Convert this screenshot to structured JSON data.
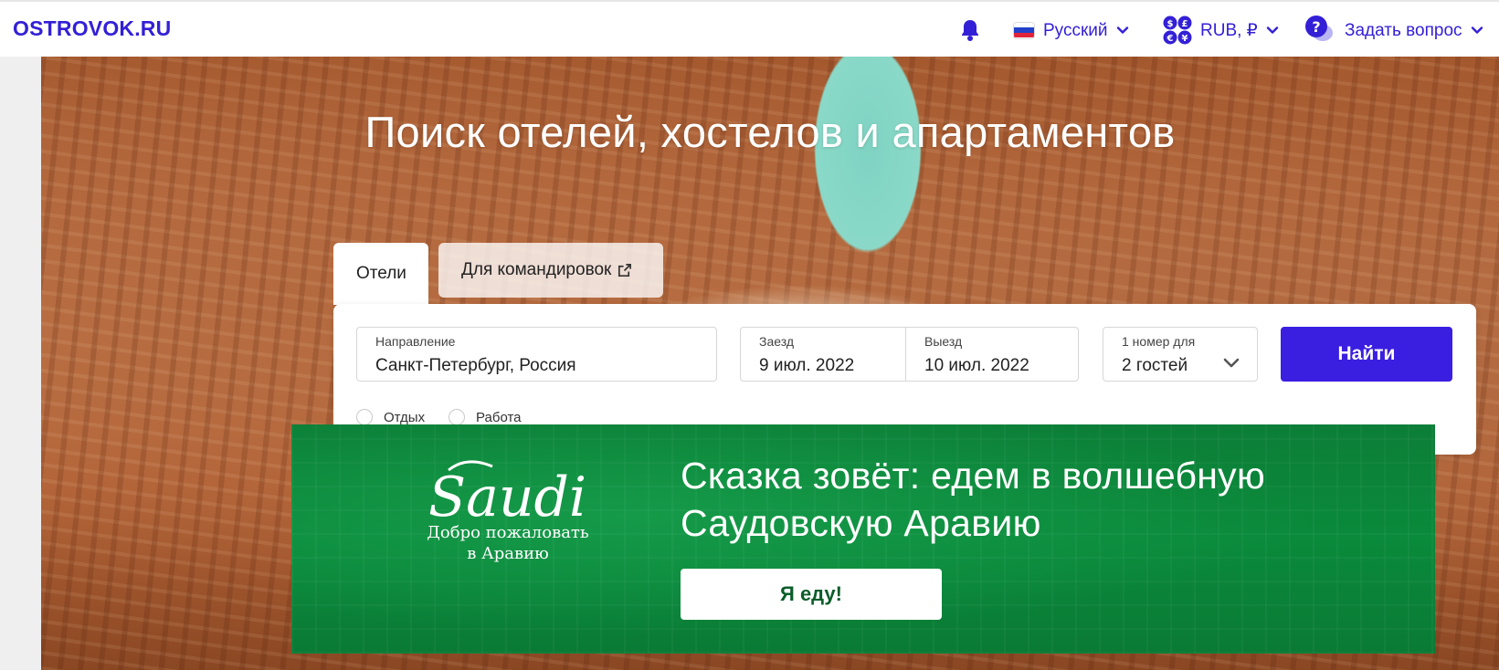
{
  "header": {
    "logo": "OSTROVOK.RU",
    "language": "Русский",
    "currency": "RUB, ₽",
    "help": "Задать вопрос"
  },
  "icons": {
    "bell": "bell-icon",
    "flag": "russia-flag-icon",
    "currency": "currency-exchange-icon",
    "help": "question-bubble-icon",
    "chevron": "chevron-down-icon",
    "external": "external-link-icon"
  },
  "colors": {
    "brand": "#3320d6",
    "search_button": "#3a1fe0",
    "promo_green": "#0a8a3b"
  },
  "hero": {
    "title": "Поиск отелей, хостелов и апартаментов"
  },
  "tabs": [
    {
      "label": "Отели",
      "active": true
    },
    {
      "label": "Для командировок",
      "active": false
    }
  ],
  "search": {
    "destination": {
      "label": "Направление",
      "value": "Санкт-Петербург, Россия"
    },
    "checkin": {
      "label": "Заезд",
      "value": "9 июл. 2022"
    },
    "checkout": {
      "label": "Выезд",
      "value": "10 июл. 2022"
    },
    "guests": {
      "label": "1 номер для",
      "value": "2 гостей"
    },
    "button": "Найти",
    "purpose": [
      {
        "label": "Отдых",
        "selected": false
      },
      {
        "label": "Работа",
        "selected": false
      }
    ]
  },
  "promo": {
    "logo_word": "Saudi",
    "logo_caption_line1": "Добро пожаловать",
    "logo_caption_line2": "в Аравию",
    "title_line1": "Сказка зовёт: едем в волшебную",
    "title_line2": "Саудовскую Аравию",
    "button": "Я еду!"
  }
}
